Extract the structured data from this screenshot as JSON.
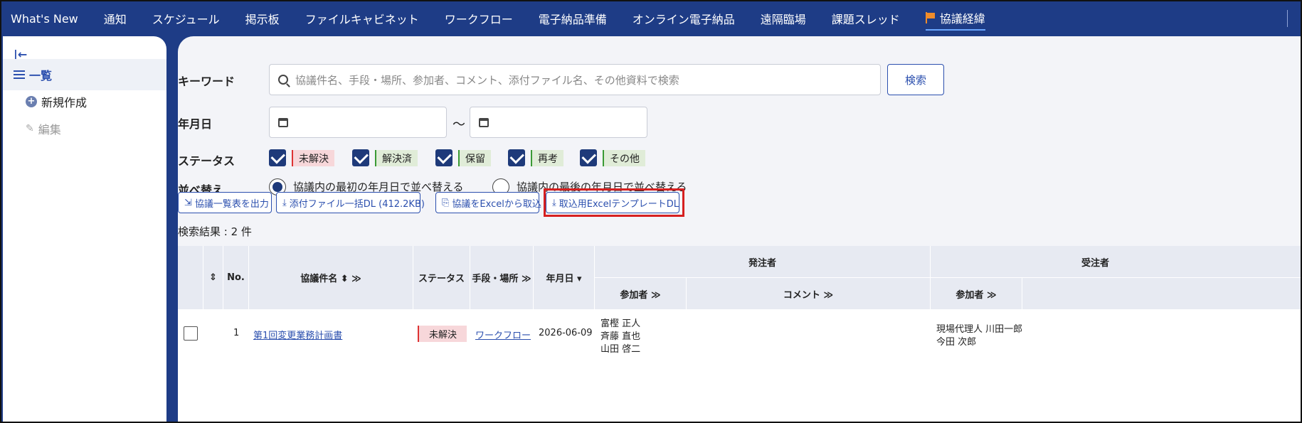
{
  "nav": {
    "items": [
      "What's New",
      "通知",
      "スケジュール",
      "掲示板",
      "ファイルキャビネット",
      "ワークフロー",
      "電子納品準備",
      "オンライン電子納品",
      "遠隔臨場",
      "課題スレッド"
    ],
    "active": "協議経緯",
    "active_icon": "flag-icon",
    "accent": "#f08c2a"
  },
  "sidebar": {
    "collapse_icon": "collapse-left-icon",
    "items": [
      {
        "label": "一覧",
        "icon": "list-icon"
      },
      {
        "label": "新規作成",
        "icon": "plus-circle-icon"
      },
      {
        "label": "編集",
        "icon": "pencil-icon"
      }
    ]
  },
  "search": {
    "keyword_label": "キーワード",
    "placeholder": "協議件名、手段・場所、参加者、コメント、添付ファイル名、その他資料で検索",
    "button": "検索",
    "date_label": "年月日",
    "date_sep": "〜",
    "status_label": "ステータス",
    "statuses": [
      "未解決",
      "解決済",
      "保留",
      "再考",
      "その他"
    ],
    "sort_label": "並べ替え",
    "sort_options": [
      "協議内の最初の年月日で並べ替える",
      "協議内の最後の年月日で並べ替える"
    ]
  },
  "actions": {
    "export": "協議一覧表を出力",
    "download_all": "添付ファイル一括DL (412.2KB)",
    "import_excel": "協議をExcelから取込",
    "template_dl": "取込用ExcelテンプレートDL"
  },
  "result_text": "検索結果 : 2 件",
  "table": {
    "headers": {
      "no": "No.",
      "title": "協議件名 ⬍ ≫",
      "status": "ステータス",
      "method": "手段・場所 ≫",
      "date": "年月日 ▾",
      "orderer": "発注者",
      "participants": "参加者 ≫",
      "comment": "コメント ≫",
      "contractor": "受注者",
      "c_participants": "参加者 ≫"
    },
    "rows": [
      {
        "no": "1",
        "title": "第1回変更業務計画書",
        "status": "未解決",
        "method": "ワークフロー",
        "date": "2026-06-09",
        "orderer_participants": [
          "富樫 正人",
          "斉藤 直也",
          "山田 啓二"
        ],
        "contractor_participants": [
          "現場代理人 川田一郎",
          "今田 次郎"
        ]
      }
    ]
  },
  "colors": {
    "nav_bg": "#1e3c86",
    "link": "#2b4fae",
    "highlight": "#d62020"
  }
}
